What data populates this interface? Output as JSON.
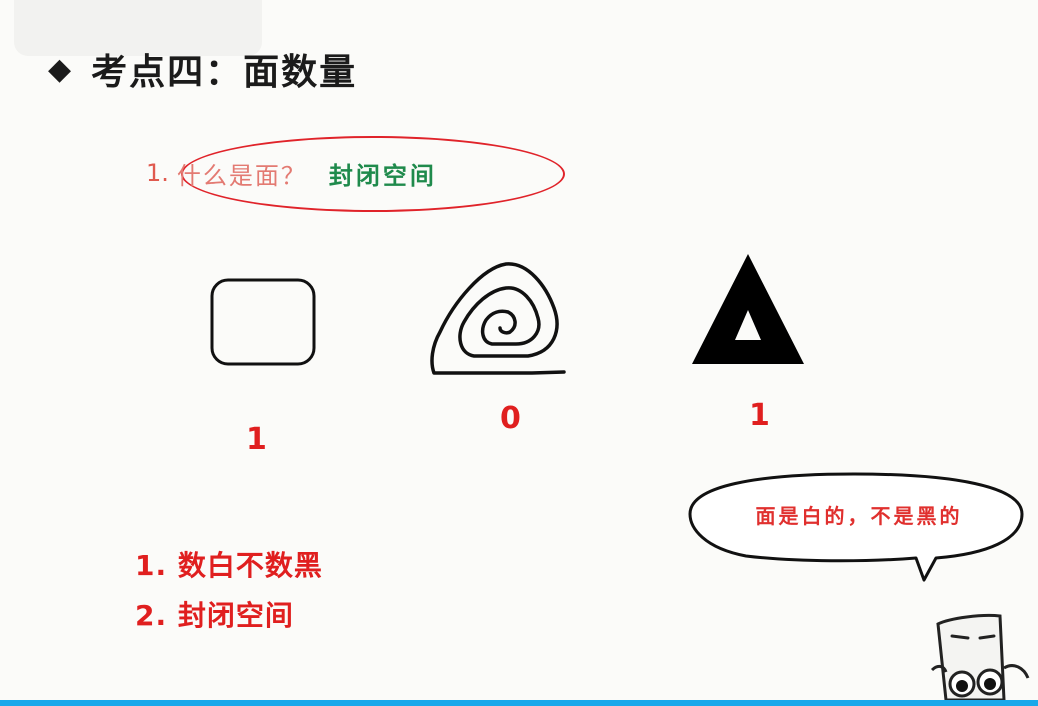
{
  "title": {
    "bullet": "◆",
    "text": "考点四：面数量"
  },
  "question": {
    "number": "1.",
    "text": "什么是面？",
    "answer": "封闭空间"
  },
  "shapes": [
    {
      "icon": "rounded-square-icon",
      "count": "1"
    },
    {
      "icon": "spiral-icon",
      "count": "0"
    },
    {
      "icon": "triangle-frame-icon",
      "count": "1"
    }
  ],
  "speech_bubble": {
    "text": "面是白的，不是黑的"
  },
  "rules": [
    "1. 数白不数黑",
    "2. 封闭空间"
  ],
  "colors": {
    "accent_red": "#e01f1f",
    "answer_green": "#1f8a4c",
    "bottom_bar": "#19a8ea"
  }
}
